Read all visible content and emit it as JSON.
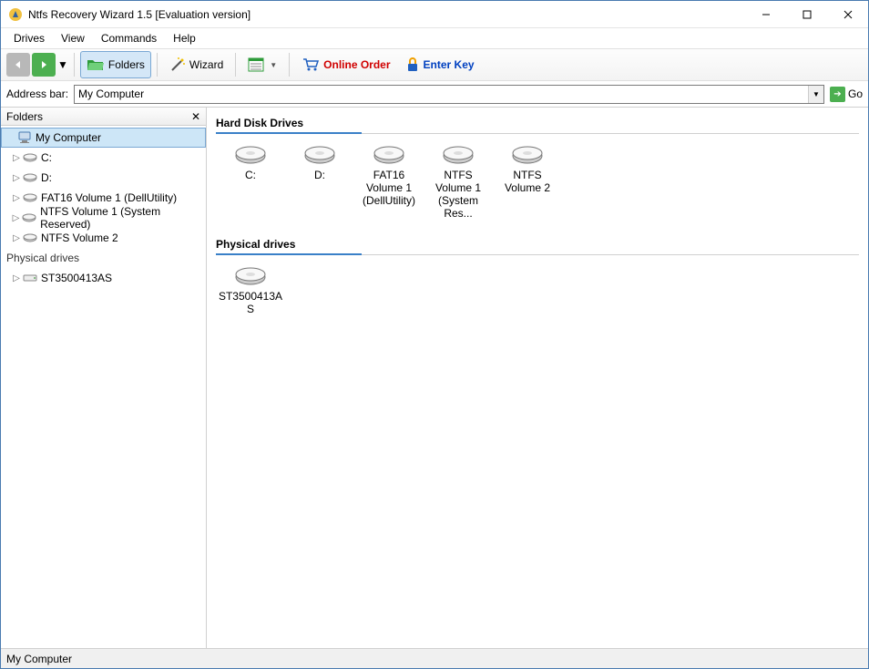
{
  "window": {
    "title": "Ntfs Recovery Wizard 1.5 [Evaluation version]"
  },
  "menubar": {
    "items": [
      "Drives",
      "View",
      "Commands",
      "Help"
    ]
  },
  "toolbar": {
    "folders_label": "Folders",
    "wizard_label": "Wizard",
    "online_order_label": "Online Order",
    "enter_key_label": "Enter Key"
  },
  "addressbar": {
    "label": "Address bar:",
    "value": "My Computer",
    "go_label": "Go"
  },
  "sidebar": {
    "title": "Folders",
    "root": "My Computer",
    "drives": [
      {
        "label": "C:"
      },
      {
        "label": "D:"
      },
      {
        "label": "FAT16 Volume 1 (DellUtility)"
      },
      {
        "label": "NTFS Volume 1 (System Reserved)"
      },
      {
        "label": "NTFS Volume 2"
      }
    ],
    "physical_header": "Physical drives",
    "physical": [
      {
        "label": "ST3500413AS"
      }
    ]
  },
  "content": {
    "hdd_header": "Hard Disk Drives",
    "hdd_items": [
      {
        "label": "C:"
      },
      {
        "label": "D:"
      },
      {
        "label": "FAT16 Volume 1 (DellUtility)"
      },
      {
        "label": "NTFS Volume 1 (System Res..."
      },
      {
        "label": "NTFS Volume 2"
      }
    ],
    "phys_header": "Physical drives",
    "phys_items": [
      {
        "label": "ST3500413AS"
      }
    ]
  },
  "statusbar": {
    "text": "My Computer"
  }
}
